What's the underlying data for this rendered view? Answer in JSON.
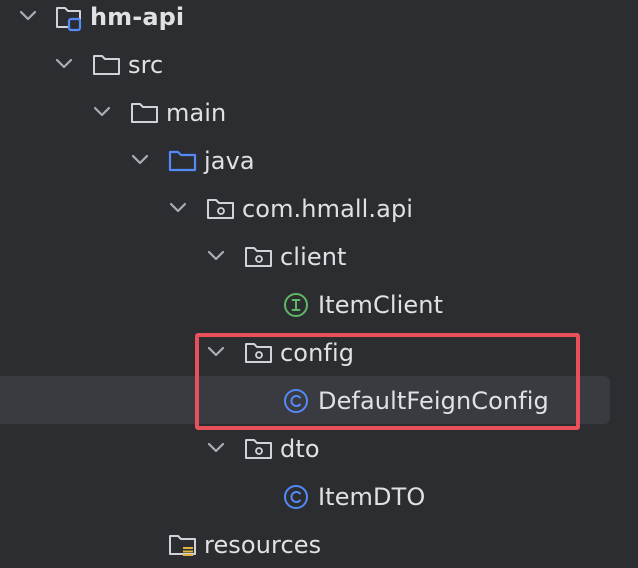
{
  "project_tree": {
    "root": {
      "label": "hm-api",
      "expanded": true,
      "icon": "module-folder-icon"
    },
    "src": {
      "label": "src",
      "expanded": true,
      "icon": "folder-icon"
    },
    "main": {
      "label": "main",
      "expanded": true,
      "icon": "folder-icon"
    },
    "java": {
      "label": "java",
      "expanded": true,
      "icon": "source-root-folder-icon"
    },
    "package": {
      "label": "com.hmall.api",
      "expanded": true,
      "icon": "package-icon"
    },
    "client_pkg": {
      "label": "client",
      "expanded": true,
      "icon": "package-icon"
    },
    "item_client": {
      "label": "ItemClient",
      "icon": "interface-icon"
    },
    "config_pkg": {
      "label": "config",
      "expanded": true,
      "icon": "package-icon"
    },
    "default_feign_config": {
      "label": "DefaultFeignConfig",
      "icon": "class-icon",
      "selected": true
    },
    "dto_pkg": {
      "label": "dto",
      "expanded": true,
      "icon": "package-icon"
    },
    "item_dto": {
      "label": "ItemDTO",
      "icon": "class-icon"
    },
    "resources": {
      "label": "resources",
      "icon": "resources-folder-icon"
    }
  },
  "colors": {
    "background": "#2b2d30",
    "selection": "#393b40",
    "text": "#dfe1e5",
    "source_folder": "#548af7",
    "interface": "#5fb865",
    "class": "#548af7",
    "highlight_box": "#e8505b"
  }
}
